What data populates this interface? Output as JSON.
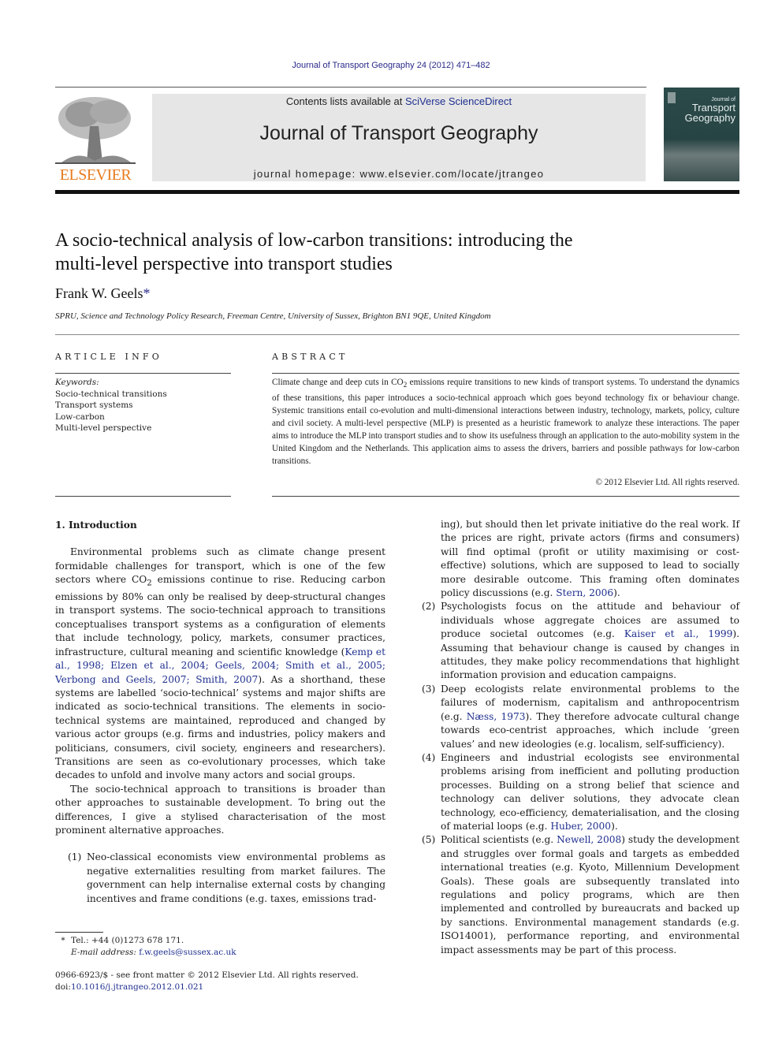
{
  "header": {
    "citation": "Journal of Transport Geography 24 (2012) 471–482",
    "contents_prefix": "Contents lists available at ",
    "contents_link": "SciVerse ScienceDirect",
    "journal_title": "Journal of Transport Geography",
    "homepage": "journal homepage: www.elsevier.com/locate/jtrangeo",
    "publisher_logo_text": "ELSEVIER",
    "cover": {
      "line1": "Journal of",
      "line2": "Transport",
      "line3": "Geography"
    },
    "colors": {
      "publisher_orange": "#e87b1e",
      "link_blue": "#1f2f8f",
      "banner_gray": "#e6e6e6",
      "cover_teal": "#2b4a4a"
    }
  },
  "article": {
    "title_line1": "A socio-technical analysis of low-carbon transitions: introducing the",
    "title_line2": "multi-level perspective into transport studies",
    "author": "Frank W. Geels",
    "author_mark": "*",
    "affiliation": "SPRU, Science and Technology Policy Research, Freeman Centre, University of Sussex, Brighton BN1 9QE, United Kingdom"
  },
  "article_info": {
    "heading": "ARTICLE INFO",
    "keywords_label": "Keywords:",
    "keywords": [
      "Socio-technical transitions",
      "Transport systems",
      "Low-carbon",
      "Multi-level perspective"
    ]
  },
  "abstract": {
    "heading": "ABSTRACT",
    "text_a": "Climate change and deep cuts in CO",
    "sub": "2",
    "text_b": " emissions require transitions to new kinds of transport systems. To understand the dynamics of these transitions, this paper introduces a socio-technical approach which goes beyond technology fix or behaviour change. Systemic transitions entail co-evolution and multi-dimensional interactions between industry, technology, markets, policy, culture and civil society. A multi-level perspective (MLP) is presented as a heuristic framework to analyze these interactions. The paper aims to introduce the MLP into transport studies and to show its usefulness through an application to the auto-mobility system in the United Kingdom and the Netherlands. This application aims to assess the drivers, barriers and possible pathways for low-carbon transitions.",
    "copyright": "© 2012 Elsevier Ltd. All rights reserved."
  },
  "body": {
    "section_heading": "1. Introduction",
    "p1_a": "Environmental problems such as climate change present formidable challenges for transport, which is one of the few sectors where CO",
    "p1_sub": "2",
    "p1_b": " emissions continue to rise. Reducing carbon emissions by 80% can only be realised by deep-structural changes in transport systems. The socio-technical approach to transitions conceptualises transport systems as a configuration of elements that include technology, policy, markets, consumer practices, infrastructure, cultural meaning and scientific knowledge (",
    "p1_cite": "Kemp et al., 1998; Elzen et al., 2004; Geels, 2004; Smith et al., 2005; Verbong and Geels, 2007; Smith, 2007",
    "p1_c": "). As a shorthand, these systems are labelled ‘socio-technical’ systems and major shifts are indicated as socio-technical transitions. The elements in socio-technical systems are maintained, reproduced and changed by various actor groups (e.g. firms and industries, policy makers and politicians, consumers, civil society, engineers and researchers). Transitions are seen as co-evolutionary processes, which take decades to unfold and involve many actors and social groups.",
    "p2": "The socio-technical approach to transitions is broader than other approaches to sustainable development. To bring out the differences, I give a stylised characterisation of the most prominent alternative approaches.",
    "items": [
      {
        "num": "(1)",
        "text_a": "Neo-classical economists view environmental problems as negative externalities resulting from market failures. The government can help internalise external costs by changing incentives and frame conditions (e.g. taxes, emissions trad-",
        "cont_a": "ing), but should then let private initiative do the real work. If the prices are right, private actors (firms and consumers) will find optimal (profit or utility maximising or cost-effective) solutions, which are supposed to lead to socially more desirable outcome. This framing often dominates policy discussions (e.g. ",
        "cite": "Stern, 2006",
        "cont_b": ")."
      },
      {
        "num": "(2)",
        "text_a": "Psychologists focus on the attitude and behaviour of individuals whose aggregate choices are assumed to produce societal outcomes (e.g. ",
        "cite": "Kaiser et al., 1999",
        "text_b": "). Assuming that behaviour change is caused by changes in attitudes, they make policy recommendations that highlight information provision and education campaigns."
      },
      {
        "num": "(3)",
        "text_a": "Deep ecologists relate environmental problems to the failures of modernism, capitalism and anthropocentrism (e.g. ",
        "cite": "Næss, 1973",
        "text_b": "). They therefore advocate cultural change towards eco-centrist approaches, which include ‘green values’ and new ideologies (e.g. localism, self-sufficiency)."
      },
      {
        "num": "(4)",
        "text_a": "Engineers and industrial ecologists see environmental problems arising from inefficient and polluting production processes. Building on a strong belief that science and technology can deliver solutions, they advocate clean technology, eco-efficiency, dematerialisation, and the closing of material loops (e.g. ",
        "cite": "Huber, 2000",
        "text_b": ")."
      },
      {
        "num": "(5)",
        "text_a": "Political scientists (e.g. ",
        "cite": "Newell, 2008",
        "text_b": ") study the development and struggles over formal goals and targets as embedded international treaties (e.g. Kyoto, Millennium Development Goals). These goals are subsequently translated into regulations and policy programs, which are then implemented and controlled by bureaucrats and backed up by sanctions. Environmental management standards (e.g. ISO14001), performance reporting, and environmental impact assessments may be part of this process."
      }
    ]
  },
  "footnote": {
    "mark": "*",
    "tel": "Tel.: +44 (0)1273 678 171.",
    "email_label": "E-mail address: ",
    "email": "f.w.geels@sussex.ac.uk"
  },
  "front_matter": {
    "issn_line": "0966-6923/$ - see front matter © 2012 Elsevier Ltd. All rights reserved.",
    "doi_label": "doi:",
    "doi": "10.1016/j.jtrangeo.2012.01.021"
  }
}
